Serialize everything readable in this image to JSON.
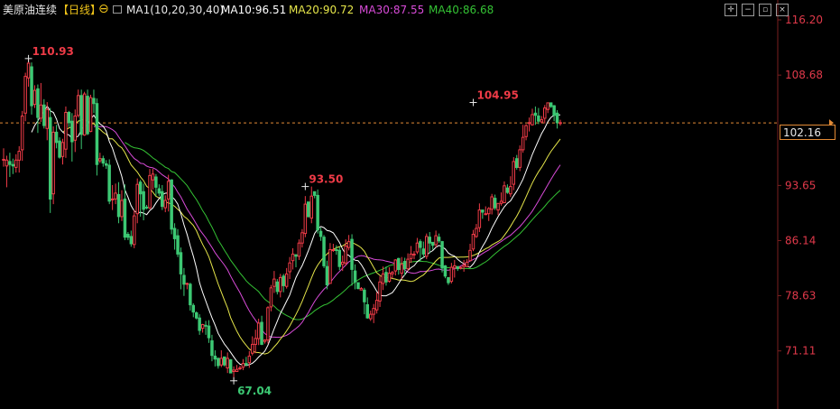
{
  "header": {
    "instrument": "美原油连续",
    "period": "【日线】",
    "ma_config": "MA1(10,20,30,40)",
    "ma10": "MA10:96.51",
    "ma20": "MA20:90.72",
    "ma30": "MA30:87.55",
    "ma40": "MA40:86.68",
    "colors": {
      "text": "#e8e8e8",
      "period": "#f0c419",
      "ma10": "#ffffff",
      "ma20": "#e6e64a",
      "ma30": "#d84bd8",
      "ma40": "#34c234"
    }
  },
  "current_price": "102.16",
  "chart_data": {
    "type": "candlestick",
    "y_ticks": [
      "116.20",
      "108.68",
      "102.16",
      "93.65",
      "86.14",
      "78.63",
      "71.11"
    ],
    "ylim": [
      63.2,
      116.2
    ],
    "annotations": [
      {
        "text": "110.93",
        "index": 8,
        "value": 110.93,
        "side": "high"
      },
      {
        "text": "93.50",
        "index": 97,
        "value": 93.5,
        "side": "high"
      },
      {
        "text": "67.04",
        "index": 74,
        "value": 67.04,
        "side": "low"
      },
      {
        "text": "104.95",
        "index": 151,
        "value": 104.95,
        "side": "high"
      }
    ],
    "current_price_line": 102.16,
    "up_color": "#ef3b47",
    "down_color": "#3cc873",
    "ma_colors": {
      "ma10": "#ffffff",
      "ma20": "#e6e64a",
      "ma30": "#d84bd8",
      "ma40": "#34c234"
    },
    "candles": [
      [
        97.2,
        97.2,
        96.2,
        98.7
      ],
      [
        96.3,
        97.1,
        93.4,
        97.7
      ],
      [
        96.9,
        96.5,
        94.8,
        98.1
      ],
      [
        96.5,
        96.3,
        95.2,
        97.3
      ],
      [
        96.1,
        97.1,
        95.4,
        97.9
      ],
      [
        97.1,
        98.3,
        95.4,
        99.0
      ],
      [
        98.5,
        103.1,
        97.0,
        103.8
      ],
      [
        103.5,
        108.5,
        102.4,
        109.0
      ],
      [
        108.3,
        110.3,
        107.1,
        110.9
      ],
      [
        109.8,
        104.5,
        103.3,
        110.4
      ],
      [
        104.7,
        106.6,
        104.2,
        107.3
      ],
      [
        106.8,
        102.9,
        100.8,
        107.4
      ],
      [
        102.8,
        104.6,
        102.3,
        107.6
      ],
      [
        104.6,
        101.8,
        101.4,
        105.4
      ],
      [
        101.4,
        104.0,
        99.8,
        105.0
      ],
      [
        102.9,
        91.8,
        89.9,
        104.2
      ],
      [
        92.5,
        100.9,
        91.1,
        101.7
      ],
      [
        100.9,
        99.5,
        98.7,
        101.9
      ],
      [
        99.7,
        97.5,
        97.3,
        100.2
      ],
      [
        97.6,
        99.5,
        96.5,
        100.0
      ],
      [
        98.6,
        103.6,
        97.4,
        104.4
      ],
      [
        103.6,
        102.2,
        101.6,
        103.8
      ],
      [
        102.4,
        99.6,
        96.9,
        103.5
      ],
      [
        99.8,
        103.1,
        98.2,
        104.0
      ],
      [
        103.2,
        105.9,
        102.9,
        106.7
      ],
      [
        105.9,
        100.6,
        98.6,
        106.7
      ],
      [
        100.5,
        106.1,
        100.4,
        106.4
      ],
      [
        105.8,
        100.7,
        100.5,
        106.7
      ],
      [
        101.0,
        105.6,
        100.9,
        106.0
      ],
      [
        105.5,
        104.8,
        103.5,
        106.7
      ],
      [
        104.8,
        96.5,
        95.0,
        105.5
      ],
      [
        97.0,
        97.3,
        96.7,
        98.1
      ],
      [
        97.3,
        96.7,
        96.2,
        97.7
      ],
      [
        96.6,
        96.4,
        95.9,
        97.1
      ],
      [
        96.4,
        91.5,
        91.1,
        97.2
      ],
      [
        91.8,
        91.8,
        90.3,
        93.7
      ],
      [
        91.8,
        92.6,
        91.1,
        93.9
      ],
      [
        92.4,
        89.4,
        88.5,
        94.1
      ],
      [
        89.4,
        91.6,
        88.8,
        93.0
      ],
      [
        91.8,
        86.6,
        86.2,
        93.8
      ],
      [
        87.0,
        86.6,
        86.2,
        87.3
      ],
      [
        86.7,
        85.7,
        85.3,
        87.5
      ],
      [
        85.6,
        89.5,
        85.1,
        90.3
      ],
      [
        89.8,
        93.8,
        88.5,
        94.6
      ],
      [
        94.1,
        92.5,
        89.4,
        94.4
      ],
      [
        92.8,
        90.4,
        88.9,
        93.9
      ],
      [
        90.7,
        90.6,
        90.4,
        91.0
      ],
      [
        90.6,
        95.0,
        90.4,
        95.9
      ],
      [
        94.4,
        95.2,
        93.1,
        95.9
      ],
      [
        94.8,
        93.4,
        92.2,
        95.2
      ],
      [
        93.2,
        92.6,
        92.2,
        93.8
      ],
      [
        92.8,
        90.8,
        90.3,
        93.7
      ],
      [
        90.6,
        91.6,
        90.0,
        92.3
      ],
      [
        91.8,
        94.2,
        90.1,
        95.1
      ],
      [
        94.4,
        87.7,
        87.0,
        94.5
      ],
      [
        87.8,
        86.4,
        84.9,
        88.5
      ],
      [
        86.8,
        84.3,
        83.9,
        87.7
      ],
      [
        84.5,
        81.6,
        79.5,
        85.2
      ],
      [
        81.4,
        80.2,
        78.6,
        82.4
      ],
      [
        80.3,
        80.3,
        79.5,
        80.4
      ],
      [
        80.2,
        77.4,
        76.6,
        80.4
      ],
      [
        77.3,
        76.4,
        75.7,
        77.6
      ],
      [
        76.3,
        75.6,
        75.4,
        76.5
      ],
      [
        75.6,
        73.9,
        73.3,
        76.1
      ],
      [
        74.2,
        74.7,
        73.6,
        74.8
      ],
      [
        74.6,
        74.5,
        73.3,
        75.2
      ],
      [
        74.5,
        72.9,
        72.2,
        75.3
      ],
      [
        72.5,
        70.5,
        69.7,
        73.3
      ],
      [
        70.4,
        70.0,
        69.0,
        71.2
      ],
      [
        70.1,
        69.1,
        68.7,
        70.2
      ],
      [
        69.2,
        70.1,
        68.9,
        71.2
      ],
      [
        70.3,
        69.2,
        69.0,
        70.3
      ],
      [
        68.8,
        70.1,
        68.1,
        70.9
      ],
      [
        69.9,
        68.1,
        68.1,
        70.0
      ],
      [
        68.3,
        68.5,
        67.0,
        69.0
      ],
      [
        68.3,
        68.6,
        68.3,
        69.2
      ],
      [
        68.8,
        68.8,
        68.5,
        69.1
      ],
      [
        68.9,
        69.4,
        68.5,
        70.0
      ],
      [
        69.4,
        69.2,
        69.1,
        70.3
      ],
      [
        69.5,
        70.4,
        68.8,
        71.1
      ],
      [
        70.8,
        72.0,
        70.5,
        73.1
      ],
      [
        72.0,
        72.8,
        70.8,
        74.0
      ],
      [
        72.8,
        74.9,
        71.9,
        75.5
      ],
      [
        75.0,
        72.0,
        71.9,
        75.9
      ],
      [
        72.4,
        72.6,
        72.1,
        72.7
      ],
      [
        72.6,
        77.0,
        72.1,
        77.2
      ],
      [
        77.1,
        79.7,
        76.5,
        80.1
      ],
      [
        79.9,
        80.9,
        79.0,
        82.0
      ],
      [
        80.5,
        79.2,
        78.8,
        80.9
      ],
      [
        79.2,
        81.1,
        78.4,
        81.6
      ],
      [
        81.3,
        80.0,
        79.1,
        81.6
      ],
      [
        79.9,
        81.6,
        79.6,
        82.4
      ],
      [
        81.9,
        83.1,
        80.9,
        83.9
      ],
      [
        83.4,
        84.3,
        82.2,
        85.1
      ],
      [
        84.2,
        84.0,
        82.5,
        84.3
      ],
      [
        84.0,
        85.8,
        83.5,
        86.3
      ],
      [
        85.8,
        87.2,
        85.2,
        87.7
      ],
      [
        87.1,
        91.1,
        86.6,
        92.2
      ],
      [
        91.4,
        89.4,
        89.3,
        91.4
      ],
      [
        89.2,
        92.2,
        88.5,
        93.5
      ],
      [
        92.8,
        92.3,
        91.9,
        92.8
      ],
      [
        92.3,
        87.6,
        87.1,
        93.1
      ],
      [
        87.4,
        86.7,
        86.1,
        87.9
      ],
      [
        86.6,
        82.7,
        82.4,
        86.9
      ],
      [
        82.6,
        80.1,
        79.5,
        83.4
      ],
      [
        80.3,
        84.9,
        80.3,
        85.8
      ],
      [
        84.8,
        84.9,
        84.6,
        85.7
      ],
      [
        84.9,
        84.8,
        84.2,
        85.5
      ],
      [
        84.8,
        82.6,
        82.1,
        85.3
      ],
      [
        82.9,
        83.2,
        82.0,
        84.1
      ],
      [
        83.1,
        85.4,
        82.7,
        86.3
      ],
      [
        85.2,
        86.0,
        84.8,
        86.9
      ],
      [
        86.3,
        82.2,
        80.0,
        87.0
      ],
      [
        82.0,
        80.5,
        79.5,
        82.9
      ],
      [
        80.4,
        79.6,
        79.5,
        80.2
      ],
      [
        79.4,
        79.6,
        79.4,
        79.8
      ],
      [
        79.4,
        77.8,
        76.1,
        79.7
      ],
      [
        77.4,
        75.6,
        75.5,
        78.4
      ],
      [
        75.5,
        76.1,
        75.2,
        76.6
      ],
      [
        76.1,
        76.9,
        74.9,
        77.5
      ],
      [
        76.7,
        78.0,
        76.2,
        79.1
      ],
      [
        77.9,
        80.5,
        77.1,
        81.3
      ],
      [
        80.3,
        81.6,
        79.4,
        82.6
      ],
      [
        81.8,
        80.5,
        80.0,
        82.6
      ],
      [
        80.6,
        81.7,
        80.4,
        82.5
      ],
      [
        81.6,
        81.8,
        81.0,
        82.0
      ],
      [
        82.0,
        83.5,
        81.4,
        83.6
      ],
      [
        83.7,
        82.2,
        81.5,
        83.8
      ],
      [
        81.7,
        82.9,
        80.9,
        83.9
      ],
      [
        83.3,
        82.3,
        81.4,
        83.8
      ],
      [
        82.3,
        83.6,
        82.0,
        84.4
      ],
      [
        83.7,
        84.3,
        83.1,
        85.4
      ],
      [
        84.2,
        84.3,
        83.6,
        84.7
      ],
      [
        84.6,
        85.8,
        84.3,
        86.5
      ],
      [
        86.0,
        85.2,
        83.3,
        86.3
      ],
      [
        85.0,
        84.3,
        83.8,
        86.0
      ],
      [
        84.0,
        86.7,
        83.6,
        87.1
      ],
      [
        86.6,
        85.8,
        84.4,
        87.3
      ],
      [
        85.9,
        85.5,
        84.9,
        85.5
      ],
      [
        85.6,
        86.8,
        85.2,
        87.5
      ],
      [
        86.6,
        86.1,
        85.8,
        87.1
      ],
      [
        86.0,
        82.4,
        81.8,
        86.1
      ],
      [
        82.7,
        81.3,
        81.0,
        82.8
      ],
      [
        81.1,
        80.4,
        80.1,
        81.1
      ],
      [
        80.6,
        82.5,
        80.3,
        83.1
      ],
      [
        82.4,
        82.7,
        81.1,
        83.5
      ],
      [
        82.6,
        82.3,
        82.0,
        82.5
      ],
      [
        82.4,
        82.5,
        82.2,
        82.6
      ],
      [
        82.6,
        82.8,
        81.9,
        83.5
      ],
      [
        82.6,
        83.2,
        82.6,
        83.6
      ],
      [
        83.4,
        84.8,
        83.3,
        85.7
      ],
      [
        85.0,
        87.0,
        84.7,
        87.6
      ],
      [
        86.7,
        87.8,
        86.5,
        88.4
      ],
      [
        87.9,
        90.3,
        87.3,
        91.2
      ],
      [
        90.3,
        90.0,
        89.1,
        90.3
      ],
      [
        89.8,
        89.8,
        89.6,
        90.8
      ],
      [
        89.8,
        90.5,
        88.8,
        90.7
      ],
      [
        90.4,
        92.1,
        89.7,
        92.5
      ],
      [
        91.9,
        90.6,
        90.3,
        92.4
      ],
      [
        90.3,
        91.2,
        89.6,
        91.1
      ],
      [
        91.2,
        91.5,
        90.9,
        92.7
      ],
      [
        91.3,
        93.6,
        91.3,
        94.2
      ],
      [
        93.3,
        92.7,
        92.5,
        93.8
      ],
      [
        92.5,
        93.5,
        92.1,
        94.9
      ],
      [
        93.8,
        96.9,
        93.0,
        97.5
      ],
      [
        97.3,
        96.1,
        95.8,
        97.8
      ],
      [
        96.1,
        98.5,
        95.6,
        99.1
      ],
      [
        98.5,
        100.2,
        98.1,
        101.9
      ],
      [
        100.3,
        101.8,
        99.8,
        102.0
      ],
      [
        102.1,
        102.2,
        101.0,
        102.9
      ],
      [
        101.9,
        103.3,
        101.8,
        104.1
      ],
      [
        103.5,
        103.2,
        101.9,
        104.4
      ],
      [
        103.1,
        102.4,
        102.0,
        104.2
      ],
      [
        102.3,
        102.6,
        102.1,
        103.1
      ],
      [
        102.8,
        104.2,
        102.1,
        104.6
      ],
      [
        104.0,
        104.9,
        103.5,
        104.9
      ],
      [
        104.9,
        104.4,
        104.2,
        104.9
      ],
      [
        104.5,
        103.2,
        102.4,
        104.6
      ],
      [
        103.5,
        102.2,
        101.4,
        103.9
      ],
      [
        102.2,
        102.2,
        101.8,
        102.6
      ]
    ]
  }
}
